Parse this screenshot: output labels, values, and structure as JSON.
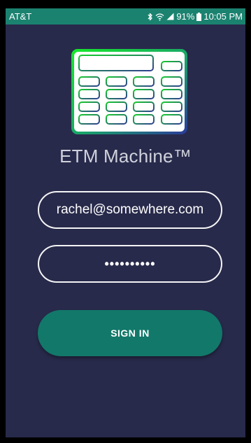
{
  "status_bar": {
    "carrier": "AT&T",
    "battery_percent": "91%",
    "time": "10:05 PM",
    "icons": [
      "bluetooth-icon",
      "wifi-icon",
      "signal-icon",
      "battery-icon"
    ]
  },
  "app": {
    "title": "ETM Machine™",
    "logo_icon": "calculator-icon"
  },
  "login": {
    "email_value": "rachel@somewhere.com",
    "password_value": "••••••••••",
    "sign_in_label": "SIGN IN"
  },
  "colors": {
    "background": "#282a4b",
    "status_bar": "#1b8270",
    "accent": "#12786a",
    "field_border": "#f4f4f6",
    "title_text": "#cfd2dc"
  }
}
